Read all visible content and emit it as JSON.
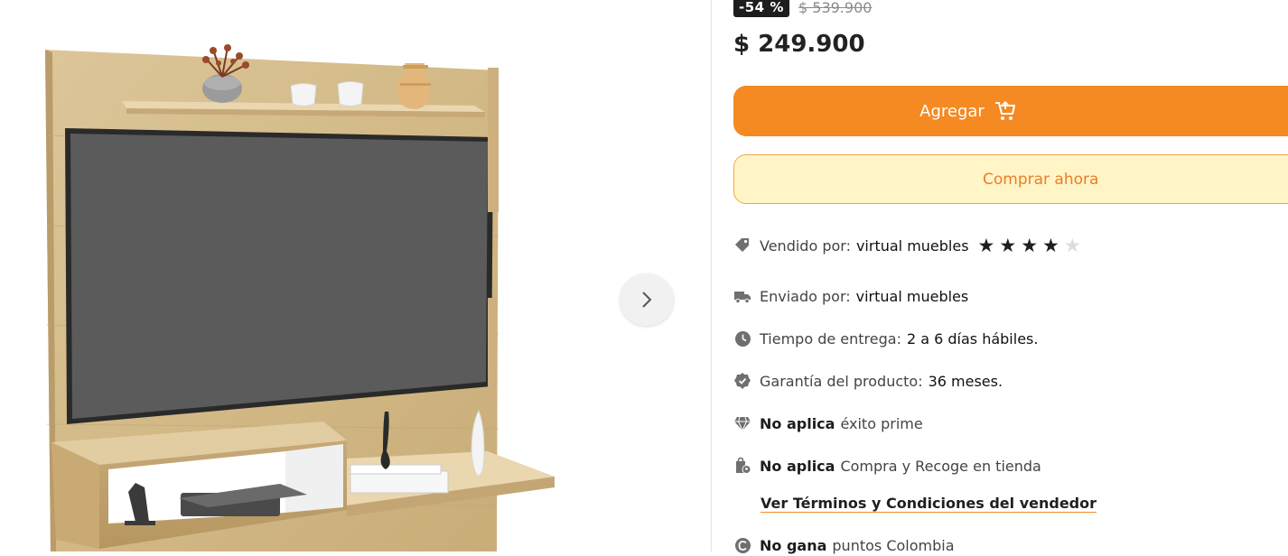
{
  "product": {
    "discount": "-54 %",
    "old_price": "$ 539.900",
    "price": "$ 249.900"
  },
  "actions": {
    "add_label": "Agregar",
    "buy_label": "Comprar ahora"
  },
  "details": {
    "sold_by_label": "Vendido por:",
    "sold_by_value": "virtual muebles",
    "rating_stars": 4,
    "rating_max": 5,
    "shipped_by_label": "Enviado por:",
    "shipped_by_value": "virtual muebles",
    "delivery_label": "Tiempo de entrega:",
    "delivery_value": "2 a 6 días hábiles.",
    "warranty_label": "Garantía del producto:",
    "warranty_value": "36 meses.",
    "prime_strong": "No aplica",
    "prime_text": "éxito prime",
    "pickup_strong": "No aplica",
    "pickup_text": "Compra y Recoge en tienda",
    "terms_link": "Ver Términos y Condiciones del vendedor",
    "points_strong": "No gana",
    "points_text": "puntos Colombia"
  },
  "icons": {
    "next": "chevron-right-icon",
    "cart": "cart-icon",
    "tag": "tag-icon",
    "truck": "truck-icon",
    "clock": "clock-icon",
    "warranty": "badge-check-icon",
    "prime": "diamond-icon",
    "pickup": "store-pickup-icon",
    "points": "points-icon"
  },
  "colors": {
    "accent": "#f58a23",
    "buy_bg": "#fff5c6",
    "buy_text": "#ec7d2a",
    "badge_bg": "#1d1d1d"
  }
}
